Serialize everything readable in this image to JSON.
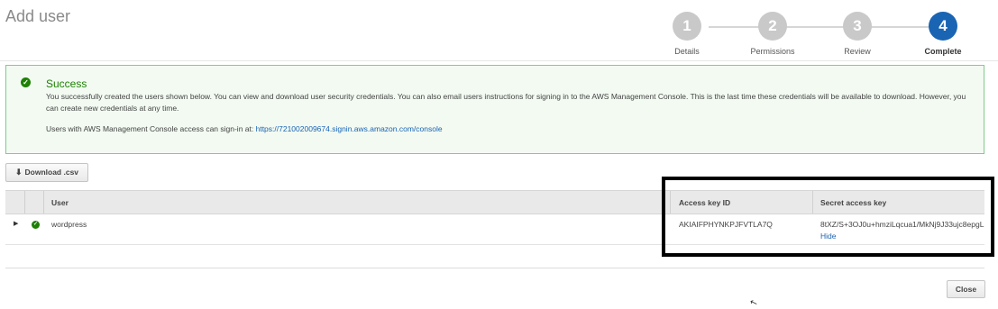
{
  "page": {
    "title": "Add user"
  },
  "stepper": {
    "steps": [
      {
        "number": "1",
        "label": "Details"
      },
      {
        "number": "2",
        "label": "Permissions"
      },
      {
        "number": "3",
        "label": "Review"
      },
      {
        "number": "4",
        "label": "Complete"
      }
    ],
    "active_step": 4
  },
  "success": {
    "title": "Success",
    "message": "You successfully created the users shown below. You can view and download user security credentials. You can also email users instructions for signing in to the AWS Management Console. This is the last time these credentials will be available to download. However, you can create new credentials at any time.",
    "signin_prefix": "Users with AWS Management Console access can sign-in at:",
    "signin_url": "https://721002009674.signin.aws.amazon.com/console"
  },
  "toolbar": {
    "download_label": "Download .csv"
  },
  "table": {
    "columns": {
      "user": "User",
      "access_key_id": "Access key ID",
      "secret_access_key": "Secret access key"
    },
    "rows": [
      {
        "user": "wordpress",
        "access_key_id": "AKIAIFPHYNKPJFVTLA7Q",
        "secret_access_key": "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",
        "secret_toggle": "Hide"
      }
    ]
  },
  "footer": {
    "close_label": "Close"
  },
  "colors": {
    "accent": "#1a64b4",
    "success": "#1d8102",
    "success_border": "#7fcc8c",
    "success_bg": "#f2faf2",
    "step_inactive": "#c9c9c9"
  }
}
